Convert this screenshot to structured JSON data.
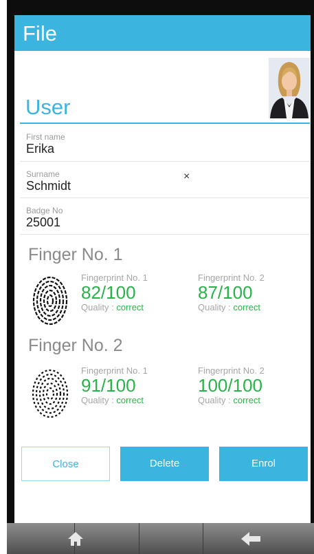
{
  "window": {
    "title": "File"
  },
  "user": {
    "heading": "User",
    "first_name": {
      "label": "First name",
      "value": "Erika"
    },
    "surname": {
      "label": "Surname",
      "value": "Schmidt"
    },
    "badge": {
      "label": "Badge No",
      "value": "25001"
    },
    "clear_glyph": "×"
  },
  "fingers": [
    {
      "title": "Finger No. 1",
      "prints": [
        {
          "label": "Fingerprint No. 1",
          "score": "82/100",
          "quality_label": "Quality :",
          "quality_value": "correct"
        },
        {
          "label": "Fingerprint No. 2",
          "score": "87/100",
          "quality_label": "Quality :",
          "quality_value": "correct"
        }
      ]
    },
    {
      "title": "Finger No. 2",
      "prints": [
        {
          "label": "Fingerprint No. 1",
          "score": "91/100",
          "quality_label": "Quality :",
          "quality_value": "correct"
        },
        {
          "label": "Fingerprint No. 2",
          "score": "100/100",
          "quality_label": "Quality :",
          "quality_value": "correct"
        }
      ]
    }
  ],
  "buttons": {
    "close": "Close",
    "delete": "Delete",
    "enrol": "Enrol"
  },
  "navbar": {
    "icons": [
      "home-icon",
      "back-arrow-icon"
    ]
  },
  "colors": {
    "accent": "#3bb4e0",
    "score_green": "#2ab24a"
  }
}
